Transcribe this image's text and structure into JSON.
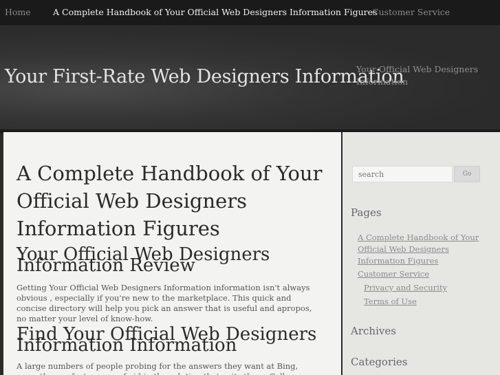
{
  "nav": {
    "items": [
      {
        "label": "Home"
      },
      {
        "label": "A Complete Handbook of Your Official Web Designers Information Figures"
      },
      {
        "label": "Customer Service"
      }
    ]
  },
  "header": {
    "site_title": "Your First-Rate Web Designers Information",
    "tagline": "Your Official Web Designers Information"
  },
  "main": {
    "title": "A Complete Handbook of Your Official Web Designers Information Figures",
    "sections": [
      {
        "heading": "Your Official Web Designers Information Review",
        "body": "Getting Your Official Web Designers Information information isn't always obvious , especially if you're new to the marketplace. This quick and concise directory will help you pick an answer that is useful and apropos, no matter your level of know-how."
      },
      {
        "heading": "Find Your Official Web Designers Information Information",
        "body": "A large numbers of people probing for the answers they want at Bing, unearth a perfect source of aid in the solution that suits them. Call industry experts and ask if"
      }
    ]
  },
  "sidebar": {
    "search": {
      "placeholder": "search",
      "button_label": "Go"
    },
    "pages_title": "Pages",
    "pages": [
      {
        "label": "A Complete Handbook of Your Official Web Designers Information Figures"
      },
      {
        "label": "Customer Service"
      },
      {
        "label": "Privacy and Security"
      },
      {
        "label": "Terms of Use"
      }
    ],
    "archives_title": "Archives",
    "categories_title": "Categories"
  },
  "colors": {
    "nav_bg": "#1a1a1a",
    "header_bg": "#2e2e2e",
    "content_bg": "#f3f4f1",
    "sidebar_bg": "#e6e6e2"
  }
}
